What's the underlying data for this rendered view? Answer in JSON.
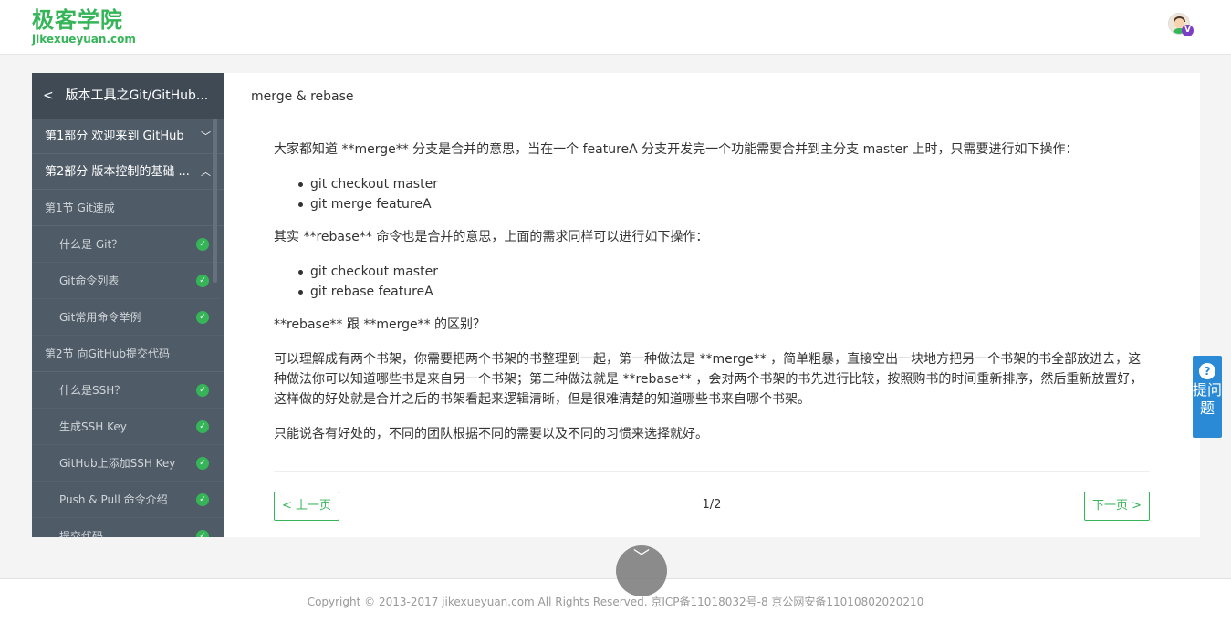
{
  "header": {
    "logo_cn": "极客学院",
    "logo_en": "jikexueyuan.com",
    "badge": "V"
  },
  "sidebar": {
    "course_title": "版本工具之Git/GitHub...",
    "parts": [
      {
        "label": "第1部分 欢迎来到 GitHub",
        "chevron": "chevron-down-icon"
      },
      {
        "label": "第2部分 版本控制的基础 ...",
        "chevron": "chevron-up-icon"
      }
    ],
    "sections": [
      {
        "label": "第1节 Git速成",
        "lessons": [
          "什么是 Git？",
          "Git命令列表",
          "Git常用命令举例"
        ]
      },
      {
        "label": "第2节 向GitHub提交代码",
        "lessons": [
          "什么是SSH？",
          "生成SSH Key",
          "GitHub上添加SSH Key",
          "Push & Pull 命令介绍",
          "提交代码"
        ]
      }
    ]
  },
  "main": {
    "title": "merge & rebase",
    "p1": "大家都知道 **merge** 分支是合并的意思，当在一个 featureA 分支开发完一个功能需要合并到主分支 master 上时，只需要进行如下操作：",
    "list1": [
      "git checkout master",
      "git merge featureA"
    ],
    "p2": "其实 **rebase** 命令也是合并的意思，上面的需求同样可以进行如下操作：",
    "list2": [
      "git checkout master",
      "git rebase featureA"
    ],
    "p3": "**rebase** 跟 **merge** 的区别？",
    "p4": "可以理解成有两个书架，你需要把两个书架的书整理到一起，第一种做法是 **merge** ，简单粗暴，直接空出一块地方把另一个书架的书全部放进去，这种做法你可以知道哪些书是来自另一个书架；第二种做法就是 **rebase** ，会对两个书架的书先进行比较，按照购书的时间重新排序，然后重新放置好，这样做的好处就是合并之后的书架看起来逻辑清晰，但是很难清楚的知道哪些书来自哪个书架。",
    "p5": "只能说各有好处的，不同的团队根据不同的需要以及不同的习惯来选择就好。",
    "prev": "< 上一页",
    "next": "下一页 >",
    "page": "1/2"
  },
  "ask_button": {
    "q": "?",
    "label": "提问题"
  },
  "footer": {
    "copyright": "Copyright © 2013-2017 jikexueyuan.com All Rights Reserved. 京ICP备11018032号-8 京公网安备11010802020210"
  },
  "colors": {
    "brand_green": "#35b558",
    "sidebar_bg": "#4f5b66",
    "ask_blue": "#2a8ad6"
  }
}
